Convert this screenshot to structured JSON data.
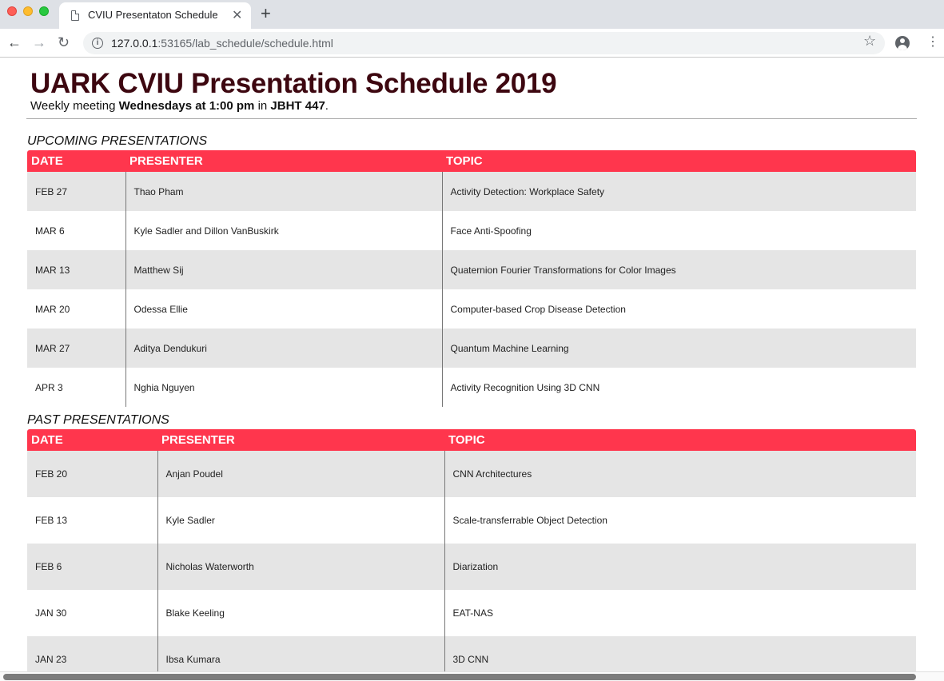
{
  "browser": {
    "tab_title": "CVIU Presentaton Schedule",
    "tab_close": "✕",
    "new_tab": "+",
    "url_host": "127.0.0.1",
    "url_rest": ":53165/lab_schedule/schedule.html",
    "icons": {
      "back": "←",
      "forward": "→",
      "reload": "↻",
      "info": "i",
      "star": "☆",
      "menu": "⋮"
    }
  },
  "page": {
    "title": "UARK CVIU Presentation Schedule 2019",
    "subtitle": {
      "prefix": "Weekly meeting ",
      "when": "Wednesdays at 1:00 pm",
      "mid": " in ",
      "where": "JBHT 447",
      "suffix": "."
    },
    "accent_color": "#ff364d",
    "title_color": "#3d0710"
  },
  "upcoming": {
    "heading": "UPCOMING PRESENTATIONS",
    "columns": [
      "DATE",
      "PRESENTER",
      "TOPIC"
    ],
    "rows": [
      {
        "date": "FEB 27",
        "presenter": "Thao Pham",
        "topic": "Activity Detection: Workplace Safety"
      },
      {
        "date": "MAR 6",
        "presenter": "Kyle Sadler and Dillon VanBuskirk",
        "topic": "Face Anti-Spoofing"
      },
      {
        "date": "MAR 13",
        "presenter": "Matthew Sij",
        "topic": "Quaternion Fourier Transformations for Color Images"
      },
      {
        "date": "MAR 20",
        "presenter": "Odessa Ellie",
        "topic": "Computer-based Crop Disease Detection"
      },
      {
        "date": "MAR 27",
        "presenter": "Aditya Dendukuri",
        "topic": "Quantum Machine Learning"
      },
      {
        "date": "APR 3",
        "presenter": "Nghia Nguyen",
        "topic": "Activity Recognition Using 3D CNN"
      }
    ]
  },
  "past": {
    "heading": "PAST PRESENTATIONS",
    "columns": [
      "DATE",
      "PRESENTER",
      "TOPIC"
    ],
    "rows": [
      {
        "date": "FEB 20",
        "presenter": "Anjan Poudel",
        "topic": "CNN Architectures"
      },
      {
        "date": "FEB 13",
        "presenter": "Kyle Sadler",
        "topic": "Scale-transferrable Object Detection"
      },
      {
        "date": "FEB 6",
        "presenter": "Nicholas Waterworth",
        "topic": "Diarization"
      },
      {
        "date": "JAN 30",
        "presenter": "Blake Keeling",
        "topic": "EAT-NAS"
      },
      {
        "date": "JAN 23",
        "presenter": "Ibsa Kumara",
        "topic": "3D CNN"
      }
    ]
  }
}
